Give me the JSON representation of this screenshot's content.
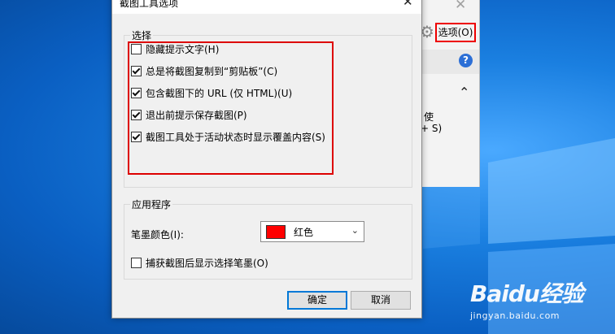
{
  "dialog": {
    "title": "截图工具选项",
    "close_symbol": "✕",
    "group_select": {
      "legend": "选择",
      "options": [
        {
          "label": "隐藏提示文字(H)",
          "checked": false
        },
        {
          "label": "总是将截图复制到“剪贴板”(C)",
          "checked": true
        },
        {
          "label": "包含截图下的 URL (仅 HTML)(U)",
          "checked": true
        },
        {
          "label": "退出前提示保存截图(P)",
          "checked": true
        },
        {
          "label": "截图工具处于活动状态时显示覆盖内容(S)",
          "checked": true
        }
      ]
    },
    "group_app": {
      "legend": "应用程序",
      "pen_color_label": "笔墨颜色(I):",
      "pen_color_value": "红色",
      "pen_color_swatch": "#ff0000",
      "show_pen_label": "捕获截图后显示选择笔墨(O)",
      "show_pen_checked": false
    },
    "ok_label": "确定",
    "cancel_label": "取消"
  },
  "background_window": {
    "close_symbol": "✕",
    "options_button": "选项(O)",
    "help_symbol": "?",
    "collapse_symbol": "⌃",
    "text_line1": "使",
    "text_line2": "+ S)"
  },
  "watermark": {
    "logo": "Baidu经验",
    "sub": "jingyan.baidu.com"
  },
  "colors": {
    "highlight": "#dd0000",
    "desktop_blue": "#0a5fc2",
    "default_button_border": "#0078d7"
  }
}
